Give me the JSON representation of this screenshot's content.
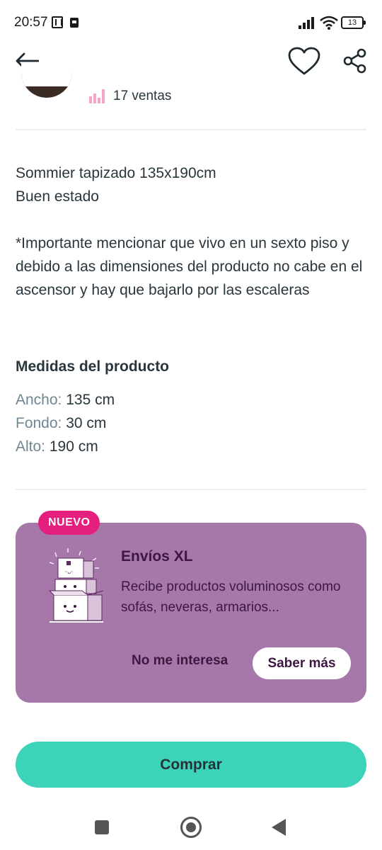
{
  "status_bar": {
    "time": "20:57",
    "battery": "13"
  },
  "header": {
    "back_icon": "arrow-left-icon",
    "favorite_icon": "heart-icon",
    "share_icon": "share-icon"
  },
  "seller": {
    "sales": "17 ventas"
  },
  "description": {
    "line1": "Sommier tapizado 135x190cm",
    "line2": "Buen estado",
    "note": "*Importante mencionar que vivo en un sexto piso y debido a las dimensiones del producto no cabe en el ascensor y hay que bajarlo por las escaleras"
  },
  "measures": {
    "title": "Medidas del producto",
    "items": [
      {
        "label": "Ancho:",
        "value": "135 cm"
      },
      {
        "label": "Fondo:",
        "value": "30 cm"
      },
      {
        "label": "Alto:",
        "value": "190 cm"
      }
    ]
  },
  "promo": {
    "badge": "NUEVO",
    "title": "Envíos XL",
    "text": "Recibe productos voluminosos como sofás, neveras, armarios...",
    "dismiss_label": "No me interesa",
    "more_label": "Saber más",
    "bg_color": "#a678aa",
    "badge_color": "#e51f7e"
  },
  "buy": {
    "label": "Comprar",
    "color": "#3dd2ba"
  }
}
